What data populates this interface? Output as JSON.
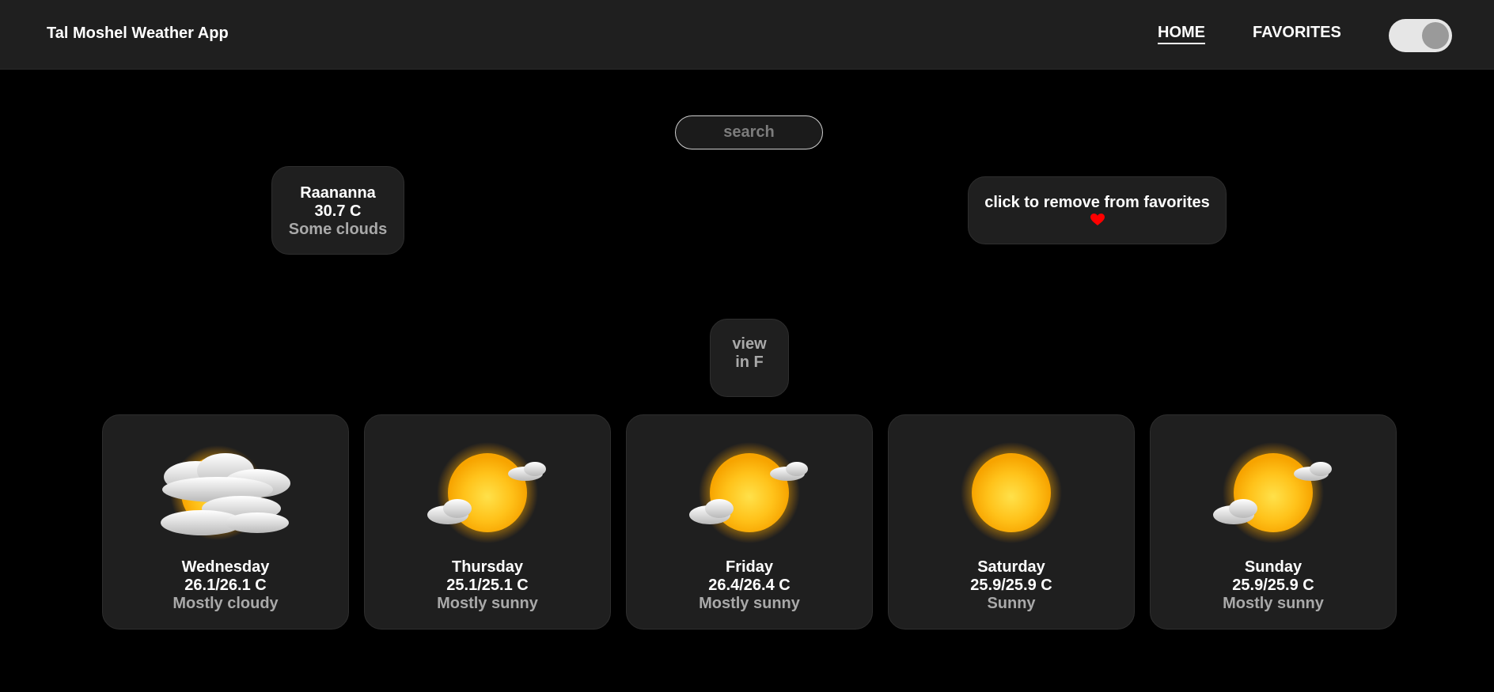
{
  "header": {
    "app_title": "Tal Moshel Weather App",
    "nav": {
      "home": "HOME",
      "favorites": "FAVORITES"
    },
    "theme_toggle_on": true
  },
  "search": {
    "placeholder": "search",
    "value": ""
  },
  "current": {
    "city": "Raananna",
    "temperature": "30.7 C",
    "condition": "Some clouds"
  },
  "favorite_button": {
    "label": "click to remove from favorites",
    "icon": "heart-icon",
    "color": "#ff0000"
  },
  "unit_button": {
    "line1": "view",
    "line2": "in F"
  },
  "forecast": [
    {
      "day": "Wednesday",
      "temps": "26.1/26.1 C",
      "condition": "Mostly cloudy",
      "icon": "mostly-cloudy-icon"
    },
    {
      "day": "Thursday",
      "temps": "25.1/25.1 C",
      "condition": "Mostly sunny",
      "icon": "mostly-sunny-icon"
    },
    {
      "day": "Friday",
      "temps": "26.4/26.4 C",
      "condition": "Mostly sunny",
      "icon": "mostly-sunny-icon"
    },
    {
      "day": "Saturday",
      "temps": "25.9/25.9 C",
      "condition": "Sunny",
      "icon": "sunny-icon"
    },
    {
      "day": "Sunday",
      "temps": "25.9/25.9 C",
      "condition": "Mostly sunny",
      "icon": "mostly-sunny-icon"
    }
  ],
  "colors": {
    "background": "#000000",
    "panel": "#1f1f1f",
    "secondary_text": "#a9a9a9",
    "heart": "#ff0000"
  }
}
